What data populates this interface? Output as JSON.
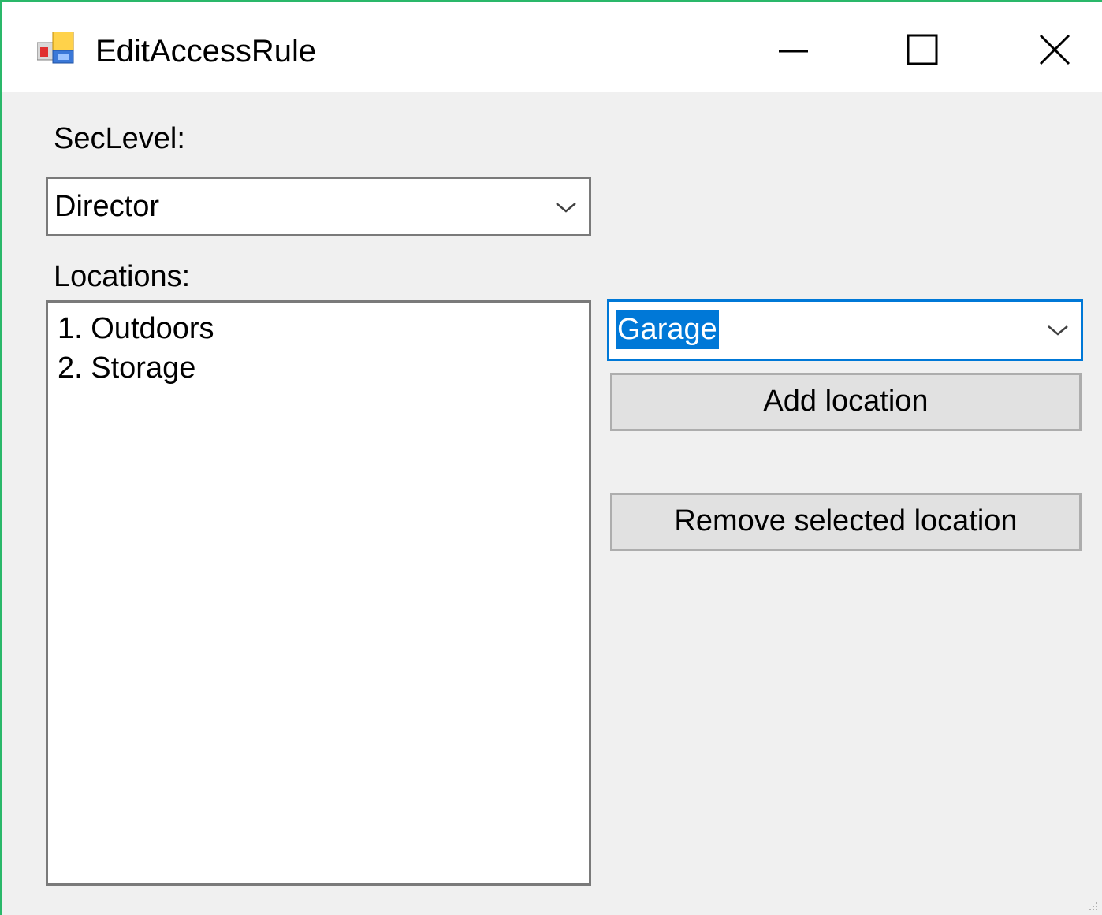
{
  "window": {
    "title": "EditAccessRule",
    "accent_border_color": "#2ab86a",
    "controls": {
      "minimize_icon": "minimize-icon",
      "maximize_icon": "maximize-icon",
      "close_icon": "close-icon"
    }
  },
  "form": {
    "seclevel": {
      "label": "SecLevel:",
      "selected_value": "Director"
    },
    "locations": {
      "label": "Locations:",
      "items": [
        "1. Outdoors",
        "2. Storage"
      ]
    },
    "location_picker": {
      "selected_value": "Garage",
      "focus_color": "#0078d7"
    },
    "buttons": {
      "add_label": "Add location",
      "remove_label": "Remove selected location"
    }
  }
}
